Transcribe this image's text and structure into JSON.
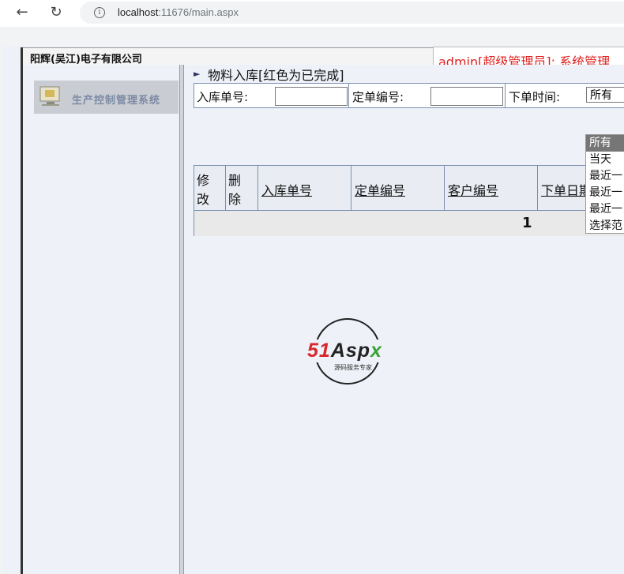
{
  "browser": {
    "back_icon": "back-arrow-icon",
    "reload_icon": "reload-icon",
    "info_icon": "info-icon",
    "url_host": "localhost",
    "url_rest": ":11676/main.aspx"
  },
  "header": {
    "company": "阳辉(吴江)电子有限公司",
    "user_text": "admin[超级管理员]: 系统管理"
  },
  "sidebar": {
    "logo_text": "生产控制管理系统"
  },
  "main": {
    "title": "物料入库[红色为已完成]",
    "search": {
      "receipt_no_label": "入库单号:",
      "receipt_no_value": "",
      "order_no_label": "定单编号:",
      "order_no_value": "",
      "order_time_label": "下单时间:",
      "order_time_selected": "所有",
      "order_time_options": [
        "所有",
        "当天",
        "最近一",
        "最近一",
        "最近一",
        "选择范"
      ]
    },
    "grid": {
      "headers": [
        "修改",
        "删除",
        "入库单号",
        "定单编号",
        "客户编号",
        "下单日期"
      ],
      "header_edit_1": "修",
      "header_edit_2": "改",
      "header_delete_1": "删",
      "header_delete_2": "除",
      "page_number": "1"
    },
    "watermark": {
      "brand_51": "51",
      "brand_a": "Asp",
      "brand_x": "x",
      "tagline": "源码服务专家"
    }
  }
}
